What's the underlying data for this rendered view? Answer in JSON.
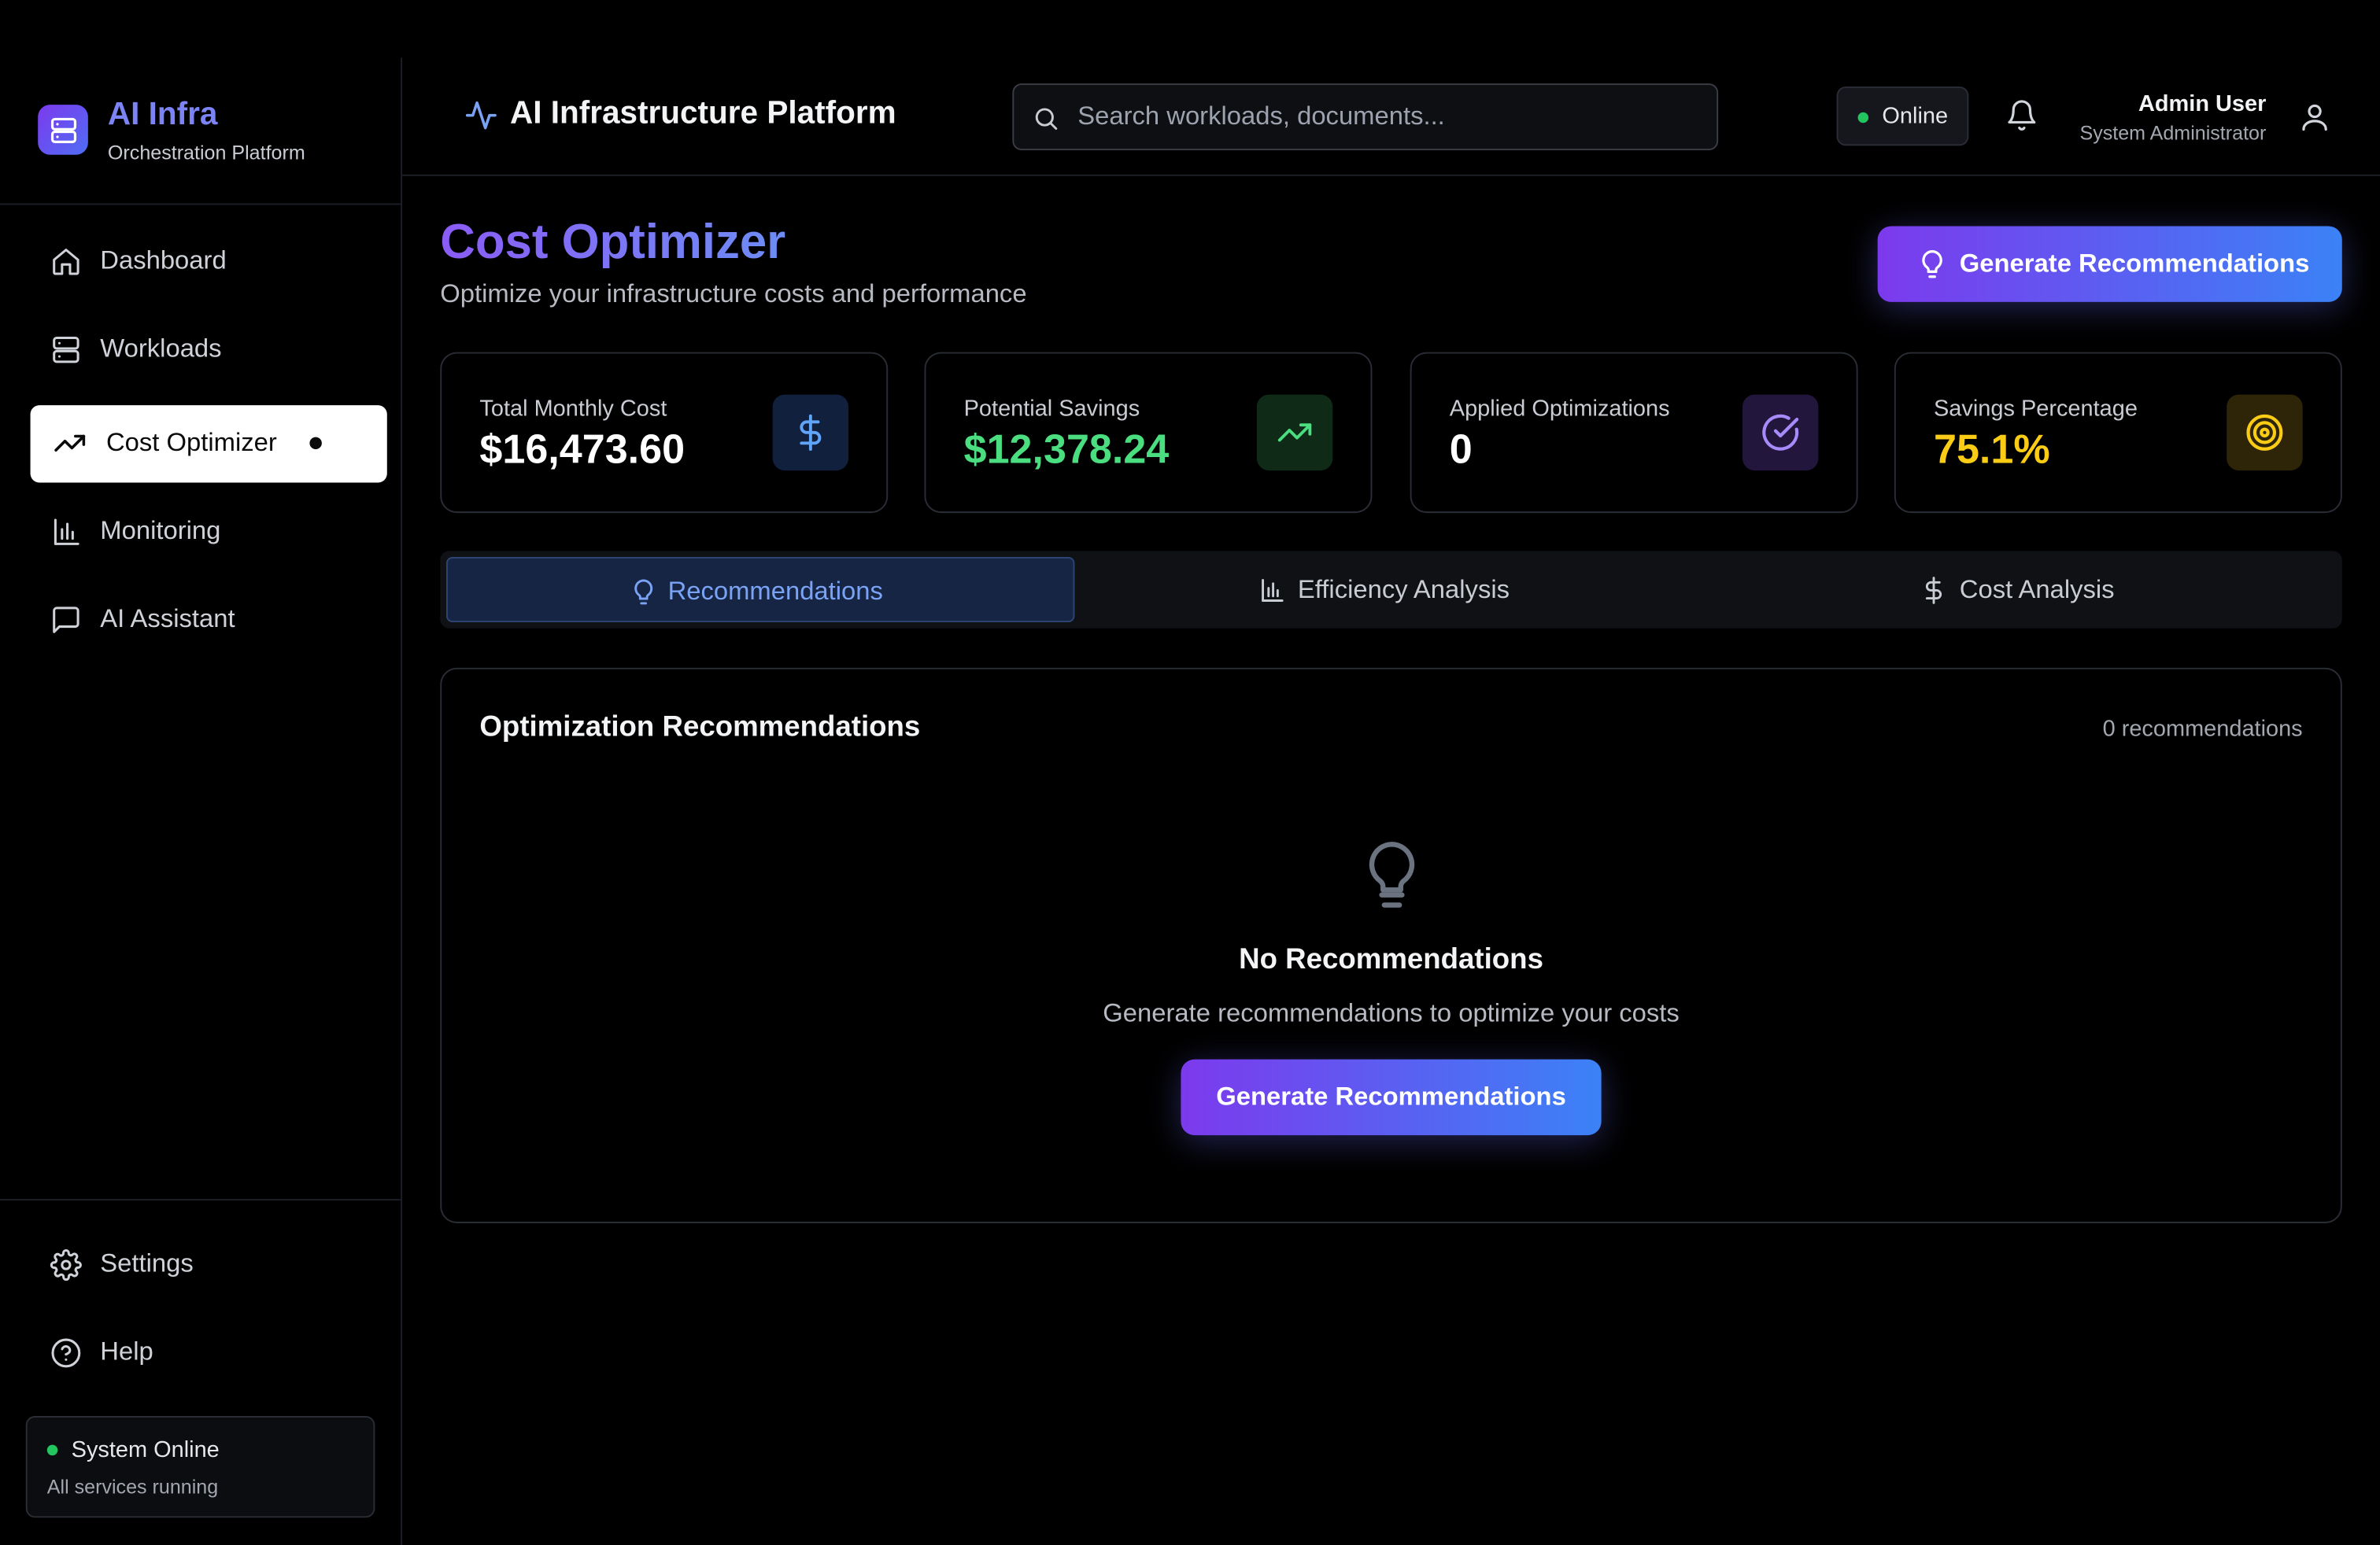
{
  "brand": {
    "title": "AI Infra",
    "subtitle": "Orchestration Platform",
    "icon": "server-stack-icon"
  },
  "sidebar": {
    "items": [
      {
        "label": "Dashboard",
        "icon": "home-icon",
        "active": false
      },
      {
        "label": "Workloads",
        "icon": "server-icon",
        "active": false
      },
      {
        "label": "Cost Optimizer",
        "icon": "trending-up-icon",
        "active": true
      },
      {
        "label": "Monitoring",
        "icon": "bar-chart-icon",
        "active": false
      },
      {
        "label": "AI Assistant",
        "icon": "message-square-icon",
        "active": false
      }
    ],
    "bottom_items": [
      {
        "label": "Settings",
        "icon": "gear-icon"
      },
      {
        "label": "Help",
        "icon": "help-circle-icon"
      }
    ],
    "status": {
      "title": "System Online",
      "detail": "All services running",
      "color": "#22c55e"
    }
  },
  "header": {
    "title": "AI Infrastructure Platform",
    "title_icon": "activity-icon",
    "search": {
      "placeholder": "Search workloads, documents...",
      "value": ""
    },
    "status_pill": "Online",
    "user": {
      "name": "Admin User",
      "role": "System Administrator"
    }
  },
  "page": {
    "title": "Cost Optimizer",
    "subtitle": "Optimize your infrastructure costs and performance",
    "primary_action": "Generate Recommendations"
  },
  "stats": [
    {
      "label": "Total Monthly Cost",
      "value": "$16,473.60",
      "icon": "dollar-icon",
      "value_color": "#ffffff",
      "icon_color": "#60a5fa",
      "badge_bg": "#10203d"
    },
    {
      "label": "Potential Savings",
      "value": "$12,378.24",
      "icon": "trending-up-icon",
      "value_color": "#4ade80",
      "icon_color": "#4ade80",
      "badge_bg": "#0f2a17"
    },
    {
      "label": "Applied Optimizations",
      "value": "0",
      "icon": "check-circle-icon",
      "value_color": "#ffffff",
      "icon_color": "#a78bfa",
      "badge_bg": "#22163d"
    },
    {
      "label": "Savings Percentage",
      "value": "75.1%",
      "icon": "target-icon",
      "value_color": "#facc15",
      "icon_color": "#facc15",
      "badge_bg": "#2e2508"
    }
  ],
  "tabs": [
    {
      "label": "Recommendations",
      "icon": "lightbulb-icon",
      "active": true
    },
    {
      "label": "Efficiency Analysis",
      "icon": "bar-chart-icon",
      "active": false
    },
    {
      "label": "Cost Analysis",
      "icon": "dollar-icon",
      "active": false
    }
  ],
  "recommendations_panel": {
    "title": "Optimization Recommendations",
    "count": "0 recommendations",
    "empty_title": "No Recommendations",
    "empty_subtitle": "Generate recommendations to optimize your costs",
    "empty_action": "Generate Recommendations",
    "empty_icon": "lightbulb-icon"
  },
  "colors": {
    "accent_start": "#7c3aed",
    "accent_end": "#3b82f6",
    "online": "#22c55e"
  }
}
